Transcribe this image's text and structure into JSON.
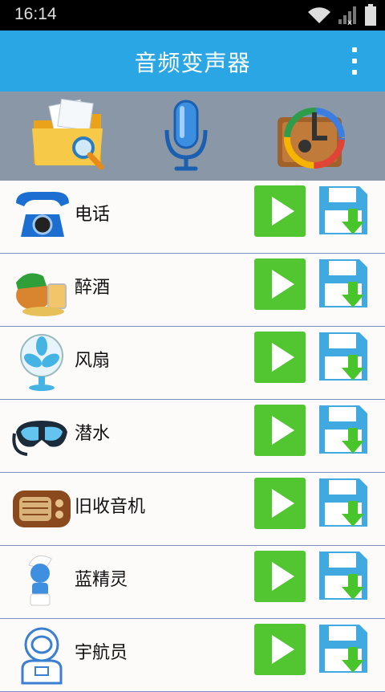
{
  "status_bar": {
    "time": "16:14"
  },
  "app_bar": {
    "title": "音频变声器"
  },
  "toolbar": {
    "items": [
      {
        "icon": "folder-search-icon"
      },
      {
        "icon": "microphone-icon"
      },
      {
        "icon": "reset-icon"
      }
    ]
  },
  "effects": [
    {
      "label": "电话",
      "icon": "telephone-icon"
    },
    {
      "label": "醉酒",
      "icon": "drunk-icon"
    },
    {
      "label": "风扇",
      "icon": "fan-icon"
    },
    {
      "label": "潜水",
      "icon": "diving-mask-icon"
    },
    {
      "label": "旧收音机",
      "icon": "old-radio-icon"
    },
    {
      "label": "蓝精灵",
      "icon": "smurf-icon"
    },
    {
      "label": "宇航员",
      "icon": "astronaut-icon"
    }
  ],
  "colors": {
    "app_bar": "#2aa6e4",
    "toolbar": "#8997a6",
    "play_button": "#52c631",
    "save_icon": "#3fa9e0",
    "divider": "#7e8fc0"
  }
}
